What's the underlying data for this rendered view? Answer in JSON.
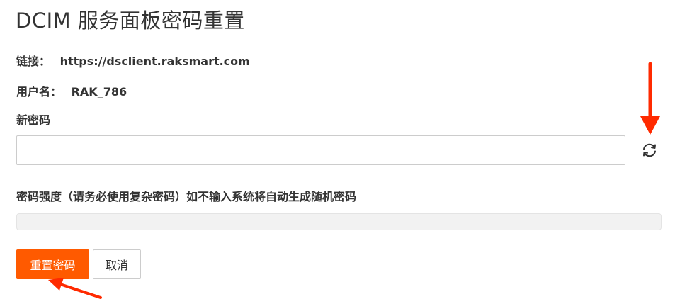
{
  "header": {
    "title": "DCIM 服务面板密码重置"
  },
  "info": {
    "link_label": "链接：",
    "link_value": "https://dsclient.raksmart.com",
    "user_label": "用户名：",
    "user_value": "RAK_786"
  },
  "form": {
    "new_password_label": "新密码",
    "new_password_value": "",
    "new_password_placeholder": "",
    "strength_label": "密码强度（请务必使用复杂密码）如不输入系统将自动生成随机密码",
    "strength_level": 0
  },
  "buttons": {
    "reset_label": "重置密码",
    "cancel_label": "取消"
  },
  "icons": {
    "refresh": "refresh-icon",
    "annotation_arrow": "red-arrow-icon"
  },
  "colors": {
    "accent": "#ff5a00",
    "annotation": "#ff2a00",
    "text": "#333333"
  }
}
